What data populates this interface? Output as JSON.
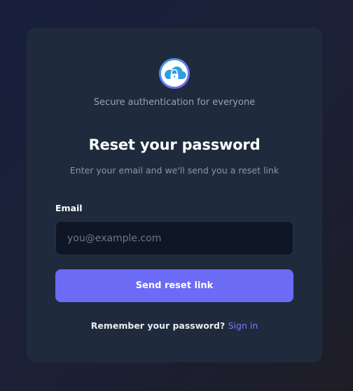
{
  "auth": {
    "tagline": "Secure authentication for everyone",
    "title": "Reset your password",
    "subtitle": "Enter your email and we'll send you a reset link",
    "email_label": "Email",
    "email_placeholder": "you@example.com",
    "email_value": "",
    "submit_label": "Send reset link",
    "footer_text": "Remember your password?",
    "signin_link": "Sign in",
    "logo_icon": "cloud-lock-icon"
  },
  "colors": {
    "accent": "#6b6bf5",
    "card": "#1f2a3c",
    "input_bg": "#0f1727",
    "link": "#7b7bf7"
  }
}
